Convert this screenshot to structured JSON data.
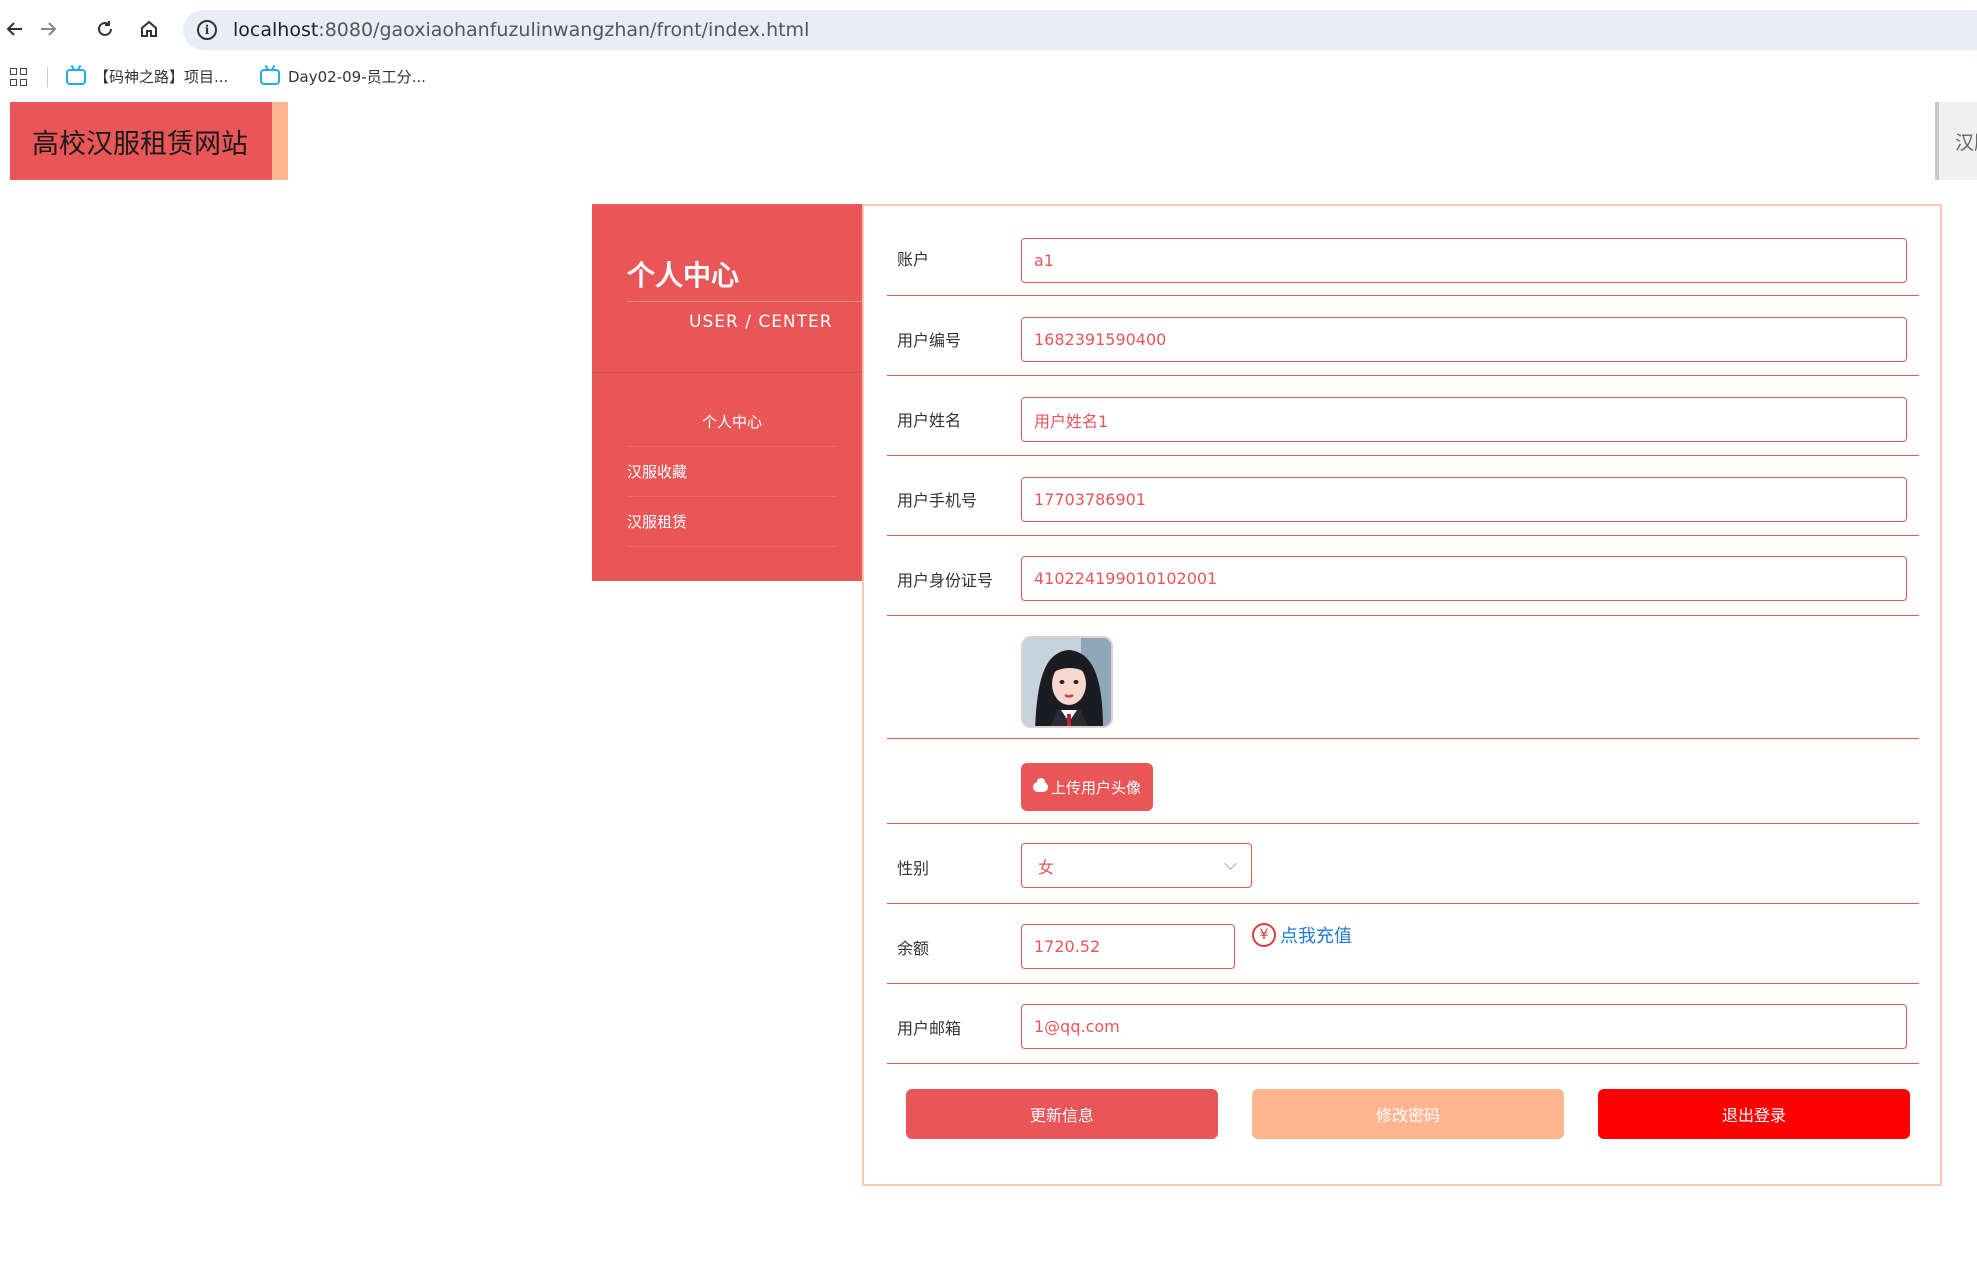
{
  "browser": {
    "url_host": "localhost",
    "url_path": ":8080/gaoxiaohanfuzulinwangzhan/front/index.html",
    "bookmarks": [
      "【码神之路】项目...",
      "Day02-09-员工分..."
    ]
  },
  "site": {
    "logo": "高校汉服租赁网站",
    "right_tab": "汉服"
  },
  "sidebar": {
    "title": "个人中心",
    "subtitle": "USER / CENTER",
    "items": [
      {
        "label": "个人中心"
      },
      {
        "label": "汉服收藏"
      },
      {
        "label": "汉服租赁"
      }
    ]
  },
  "form": {
    "account_label": "账户",
    "account_value": "a1",
    "user_no_label": "用户编号",
    "user_no_value": "1682391590400",
    "name_label": "用户姓名",
    "name_value": "用户姓名1",
    "phone_label": "用户手机号",
    "phone_value": "17703786901",
    "id_label": "用户身份证号",
    "id_value": "410224199010102001",
    "upload_label": "上传用户头像",
    "gender_label": "性别",
    "gender_value": "女",
    "balance_label": "余额",
    "balance_value": "1720.52",
    "recharge_label": "点我充值",
    "recharge_symbol": "¥",
    "email_label": "用户邮箱",
    "email_value": "1@qq.com"
  },
  "actions": {
    "update": "更新信息",
    "change_password": "修改密码",
    "logout": "退出登录"
  },
  "colors": {
    "primary": "#e95658",
    "accent": "#ffb590",
    "danger": "#ff0000",
    "link": "#1e7ad8"
  }
}
